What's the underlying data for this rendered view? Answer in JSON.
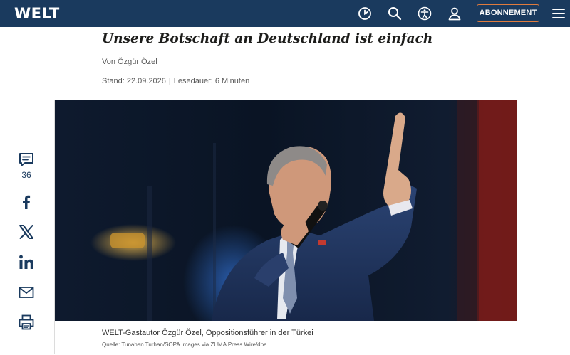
{
  "header": {
    "logo": "WELT",
    "icons": [
      "clock-icon",
      "search-icon",
      "accessibility-icon",
      "user-icon",
      "menu-icon"
    ],
    "subscribe_label": "ABONNEMENT",
    "colors": {
      "bar": "#1a3a5e",
      "accent": "#e07b3d"
    }
  },
  "article": {
    "headline": "Unsere Botschaft an Deutschland ist einfach",
    "author": "Von Özgür Özel",
    "date": "Stand: 22.09.2026",
    "separator": "|",
    "reading_time": "Lesedauer: 6 Minuten"
  },
  "image": {
    "caption": "WELT-Gastautor Özgür Özel, Oppositionsführer in der Türkei",
    "credit": "Quelle: Tunahan Turhan/SOPA Images via ZUMA Press Wire/dpa"
  },
  "social": {
    "comment_count": "36",
    "icons": [
      "comment-icon",
      "facebook-icon",
      "x-icon",
      "linkedin-icon",
      "mail-icon",
      "print-icon"
    ]
  }
}
